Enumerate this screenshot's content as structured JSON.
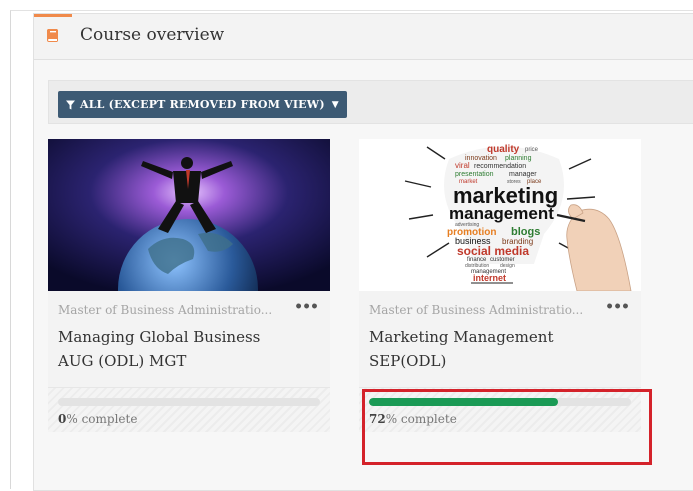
{
  "block": {
    "title": "Course overview",
    "icon": "book-icon",
    "accent_color": "#f08a4b"
  },
  "filter": {
    "label": "ALL (EXCEPT REMOVED FROM VIEW)",
    "icon": "funnel-icon",
    "color": "#3d5a74"
  },
  "courses": [
    {
      "category": "Master of Business Administratio...",
      "name_line1": "Managing Global Business",
      "name_line2": "AUG (ODL) MGT",
      "progress_number": "0",
      "progress_suffix": "% complete",
      "progress": 0,
      "menu_icon": "more-icon"
    },
    {
      "category": "Master of Business Administratio...",
      "name_line1": "Marketing Management",
      "name_line2": "SEP(ODL)",
      "progress_number": "72",
      "progress_suffix": "% complete",
      "progress": 72,
      "menu_icon": "more-icon",
      "image_words": {
        "quality": "quality",
        "price": "price",
        "innovation": "innovation",
        "planning": "planning",
        "viral": "viral",
        "recommendation": "recommendation",
        "presentation": "presentation",
        "manager": "manager",
        "market": "market",
        "stores": "stores",
        "place": "place",
        "marketing": "marketing",
        "management": "management",
        "advertising": "advertising",
        "promotion": "promotion",
        "blogs": "blogs",
        "business": "business",
        "branding": "branding",
        "social_media": "social media",
        "finance": "finance",
        "customer": "customer",
        "distribution": "distribution",
        "design": "design",
        "internet": "internet"
      }
    }
  ],
  "colors": {
    "progress_fill": "#1a9a55",
    "highlight": "#d4222a"
  }
}
